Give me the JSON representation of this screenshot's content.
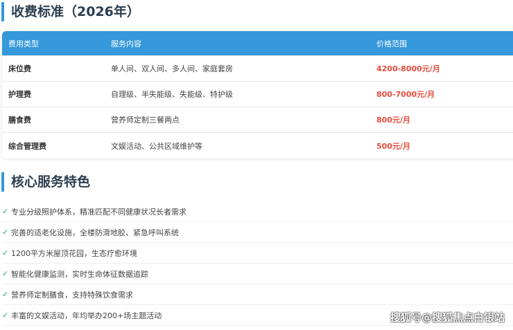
{
  "fee_section": {
    "title": "收费标准（2026年）",
    "headers": [
      "费用类型",
      "服务内容",
      "价格范围"
    ],
    "rows": [
      {
        "type": "床位费",
        "content": "单人间、双人间、多人间、家庭套房",
        "price": "4200-8000元/月"
      },
      {
        "type": "护理费",
        "content": "自理级、半失能级、失能级、特护级",
        "price": "800-7000元/月"
      },
      {
        "type": "膳食费",
        "content": "营养师定制三餐两点",
        "price": "800元/月"
      },
      {
        "type": "综合管理费",
        "content": "文娱活动、公共区域维护等",
        "price": "500元/月"
      }
    ]
  },
  "feature_section": {
    "title": "核心服务特色",
    "check": "✓",
    "items": [
      "专业分级照护体系，精准匹配不同健康状况长者需求",
      "完善的适老化设施，全楼防滑地胶、紧急呼叫系统",
      "1200平方米屋顶花园，生态疗愈环境",
      "智能化健康监测，实时生命体征数据追踪",
      "营养师定制膳食，支持特殊饮食需求",
      "丰富的文娱活动，年均举办200+场主题活动"
    ]
  },
  "watermark": "搜狐号@搜狐焦点白银站",
  "colors": {
    "accent": "#3498db",
    "price": "#e74c3c",
    "check": "#27ae60"
  }
}
